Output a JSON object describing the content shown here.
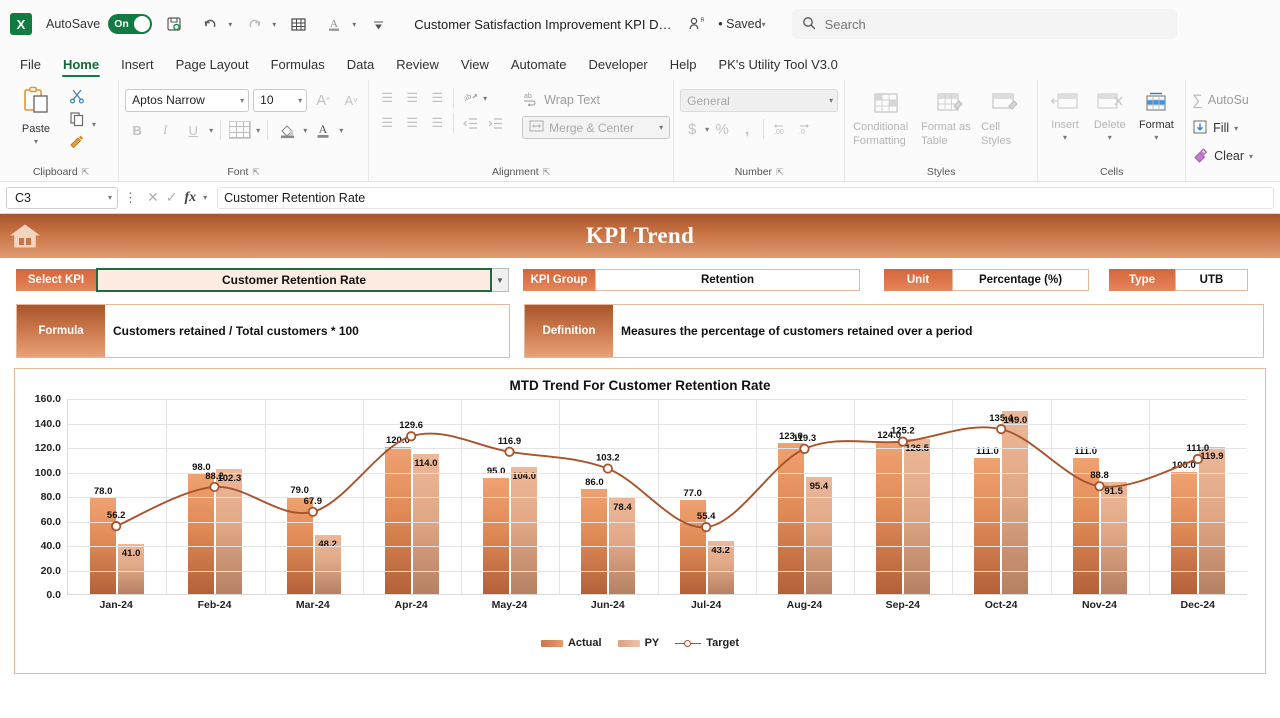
{
  "titlebar": {
    "app_icon": "excel-logo",
    "autosave_label": "AutoSave",
    "autosave_state": "On",
    "document_title": "Customer Satisfaction Improvement KPI Dashb...",
    "saved_status": "• Saved",
    "quick_access": [
      "save-icon",
      "undo-icon",
      "redo-icon",
      "table-icon",
      "font-color-icon",
      "customize-qat-icon"
    ],
    "search_placeholder": "Search"
  },
  "tabs": [
    {
      "label": "File",
      "active": false
    },
    {
      "label": "Home",
      "active": true
    },
    {
      "label": "Insert",
      "active": false
    },
    {
      "label": "Page Layout",
      "active": false
    },
    {
      "label": "Formulas",
      "active": false
    },
    {
      "label": "Data",
      "active": false
    },
    {
      "label": "Review",
      "active": false
    },
    {
      "label": "View",
      "active": false
    },
    {
      "label": "Automate",
      "active": false
    },
    {
      "label": "Developer",
      "active": false
    },
    {
      "label": "Help",
      "active": false
    },
    {
      "label": "PK's Utility Tool V3.0",
      "active": false
    }
  ],
  "ribbon": {
    "clipboard": {
      "label": "Clipboard",
      "paste": "Paste",
      "cut": "cut-icon",
      "copy": "copy-icon",
      "format_painter": "format-painter-icon"
    },
    "font": {
      "label": "Font",
      "font_name": "Aptos Narrow",
      "font_size": "10",
      "grow": "A",
      "shrink": "A",
      "bold": "B",
      "italic": "I",
      "underline": "U",
      "borders": "borders-icon",
      "fill_color": "fill-color-icon",
      "font_color": "font-color-icon"
    },
    "alignment": {
      "label": "Alignment",
      "wrap_text": "Wrap Text",
      "merge_center": "Merge & Center",
      "orientation": "orientation-icon",
      "indent_decrease": "decrease-indent-icon",
      "indent_increase": "increase-indent-icon"
    },
    "number": {
      "label": "Number",
      "format": "General",
      "currency": "$",
      "percent": "%",
      "comma": "‰",
      "decimal_increase": "increase-decimal-icon",
      "decimal_decrease": "decrease-decimal-icon"
    },
    "styles": {
      "label": "Styles",
      "conditional_formatting": "Conditional Formatting",
      "format_as_table": "Format as Table",
      "cell_styles": "Cell Styles"
    },
    "cells": {
      "label": "Cells",
      "insert": "Insert",
      "delete": "Delete",
      "format": "Format"
    },
    "editing": {
      "autosum": "AutoSu",
      "fill": "Fill",
      "clear": "Clear"
    }
  },
  "formula_bar": {
    "name_box": "C3",
    "formula": "Customer Retention Rate",
    "cancel_icon": "cancel-icon",
    "enter_icon": "enter-icon",
    "fx_icon": "fx-icon"
  },
  "banner": {
    "home_icon": "home-icon",
    "title": "KPI Trend"
  },
  "selectors": {
    "select_kpi_label": "Select KPI",
    "select_kpi_value": "Customer Retention Rate",
    "kpi_group_label": "KPI Group",
    "kpi_group_value": "Retention",
    "unit_label": "Unit",
    "unit_value": "Percentage (%)",
    "type_label": "Type",
    "type_value": "UTB"
  },
  "info": {
    "formula_label": "Formula",
    "formula_value": "Customers retained / Total customers * 100",
    "definition_label": "Definition",
    "definition_value": "Measures the percentage of customers retained over a period"
  },
  "colors": {
    "accent_orange": "#c9764a",
    "banner_dark": "#a9552a",
    "actual_bar": "#e08a56",
    "py_bar": "#e0a886",
    "target_line": "#a8532a",
    "excel_green": "#107c41"
  },
  "chart_data": {
    "type": "bar",
    "title": "MTD Trend For Customer Retention Rate",
    "xlabel": "",
    "ylabel": "",
    "ylim": [
      0,
      160
    ],
    "ytick_labels": [
      "0.0",
      "20.0",
      "40.0",
      "60.0",
      "80.0",
      "100.0",
      "120.0",
      "140.0",
      "160.0"
    ],
    "yticks": [
      0,
      20,
      40,
      60,
      80,
      100,
      120,
      140,
      160
    ],
    "grid": true,
    "legend_position": "bottom",
    "categories": [
      "Jan-24",
      "Feb-24",
      "Mar-24",
      "Apr-24",
      "May-24",
      "Jun-24",
      "Jul-24",
      "Aug-24",
      "Sep-24",
      "Oct-24",
      "Nov-24",
      "Dec-24"
    ],
    "series": [
      {
        "name": "Actual",
        "type": "bar",
        "values": [
          78.0,
          98.0,
          79.0,
          120.0,
          95.0,
          86.0,
          77.0,
          123.0,
          124.0,
          111.0,
          111.0,
          100.0
        ],
        "labels": [
          "78.0",
          "98.0",
          "79.0",
          "120.0",
          "95.0",
          "86.0",
          "77.0",
          "123.0",
          "124.0",
          "111.0",
          "111.0",
          "100.0"
        ]
      },
      {
        "name": "PY",
        "type": "bar",
        "values": [
          41.0,
          102.3,
          48.2,
          114.0,
          104.0,
          78.4,
          43.2,
          95.4,
          126.5,
          149.0,
          91.5,
          119.9
        ],
        "labels": [
          "41.0",
          "102.3",
          "48.2",
          "114.0",
          "104.0",
          "78.4",
          "43.2",
          "95.4",
          "126.5",
          "149.0",
          "91.5",
          "119.9"
        ]
      },
      {
        "name": "Target",
        "type": "line",
        "values": [
          56.2,
          88.2,
          67.9,
          129.6,
          116.9,
          103.2,
          55.4,
          119.3,
          125.2,
          135.4,
          88.8,
          111.0
        ],
        "labels": [
          "56.2",
          "88.2",
          "67.9",
          "129.6",
          "116.9",
          "103.2",
          "55.4",
          "119.3",
          "125.2",
          "135.4",
          "88.8",
          "111.0"
        ]
      }
    ]
  }
}
